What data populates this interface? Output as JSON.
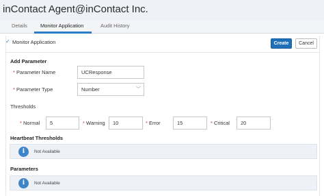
{
  "app": {
    "title": "inContact Agent@inContact Inc."
  },
  "tabs": [
    {
      "label": "Details"
    },
    {
      "label": "Monitor Application"
    },
    {
      "label": "Audit History"
    }
  ],
  "active_tab": "Monitor Application",
  "monitor": {
    "label": "Monitor Application",
    "checked": true
  },
  "actions": {
    "create": "Create",
    "cancel": "Cancel"
  },
  "add_parameter": {
    "heading": "Add Parameter",
    "name_label": "Parameter Name",
    "name_value": "UCResponse",
    "type_label": "Parameter Type",
    "type_value": "Number"
  },
  "thresholds": {
    "heading": "Thresholds",
    "normal_label": "Normal",
    "normal_value": "5",
    "warning_label": "Warning",
    "warning_value": "10",
    "error_label": "Error",
    "error_value": "15",
    "critical_label": "Critical",
    "critical_value": "20"
  },
  "heartbeat": {
    "heading": "Heartbeat Thresholds",
    "message": "Not Available"
  },
  "parameters": {
    "heading": "Parameters",
    "message": "Not Available"
  },
  "colors": {
    "accent": "#2a7cc7",
    "primary_button": "#1f6fb8",
    "required": "#d0342c",
    "info": "#3e86c8"
  },
  "icons": {
    "info": "info-icon",
    "checkbox": "check-icon",
    "select": "chevron-down-icon"
  }
}
